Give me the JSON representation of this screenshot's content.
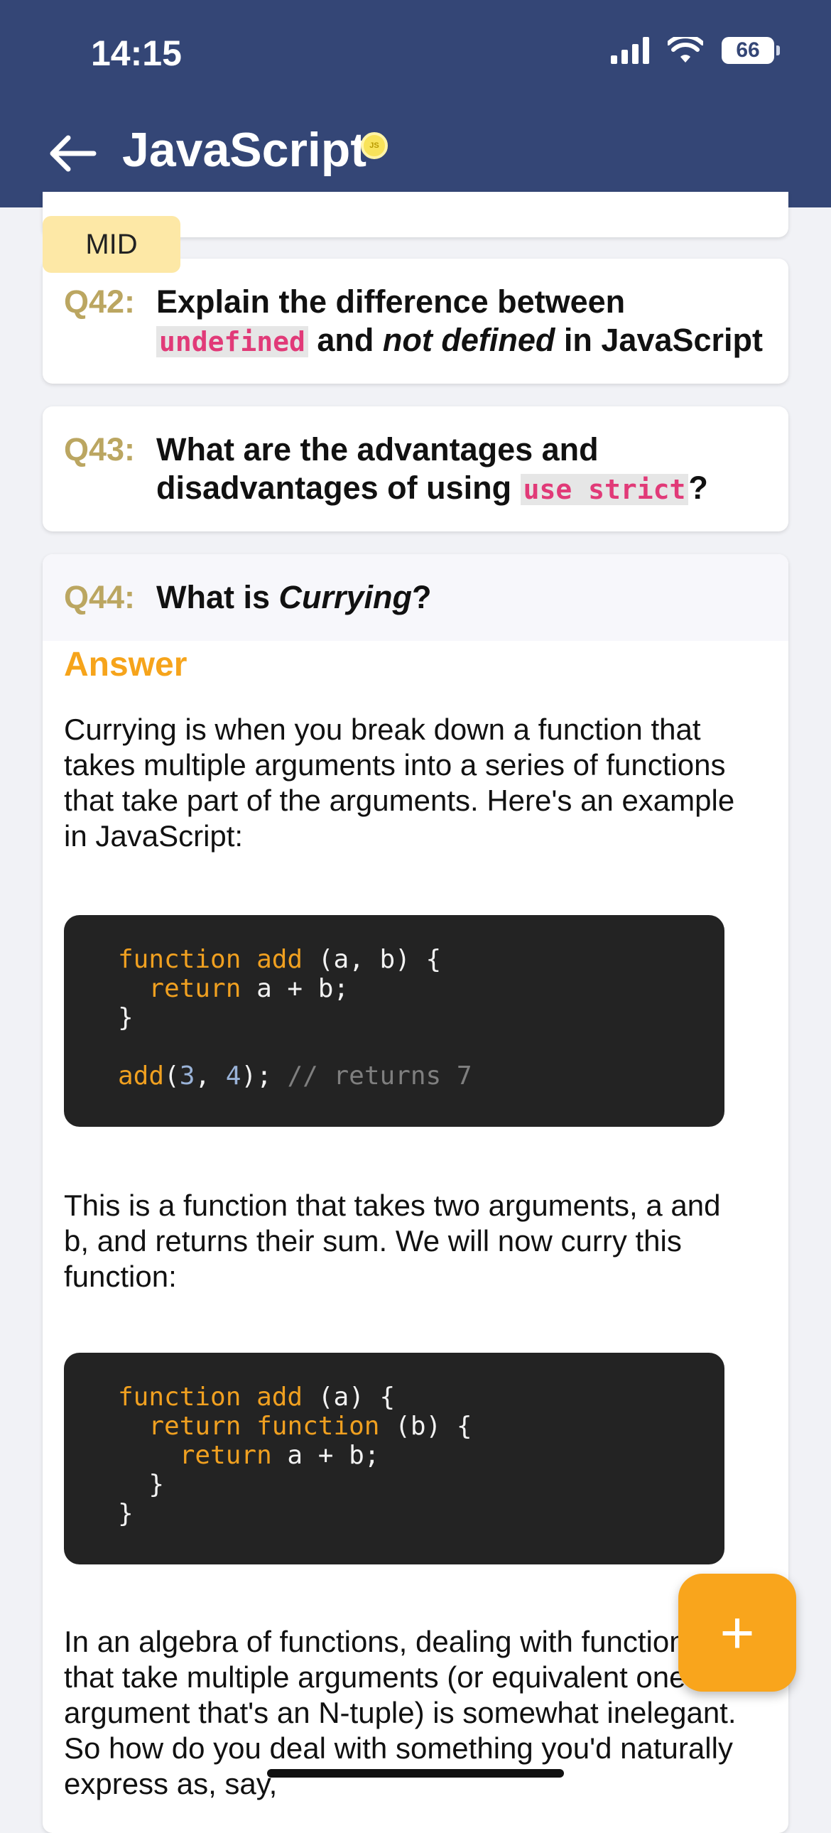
{
  "status_bar": {
    "time": "14:15",
    "battery": "66"
  },
  "header": {
    "title": "JavaScript",
    "badge": "JS"
  },
  "difficulty": "MID",
  "questions": [
    {
      "num": "Q42:",
      "text_a": "Explain the difference between",
      "code": "undefined",
      "text_b": " and ",
      "em": "not defined",
      "text_c": " in JavaScript"
    },
    {
      "num": "Q43:",
      "text_a": "What are the advantages and disadvantages of using ",
      "code": "use strict",
      "text_b": "?"
    },
    {
      "num": "Q44:",
      "text_a": "What is ",
      "em": "Currying",
      "text_b": "?"
    }
  ],
  "answer": {
    "label": "Answer",
    "p1": "Currying is when you break down a function that takes multiple arguments into a series of functions that take part of the arguments. Here's an example in JavaScript:",
    "p2": "This is a function that takes two arguments, a and b, and returns their sum. We will now curry this function:",
    "p3": "In an algebra of functions, dealing with functions that take multiple arguments (or equivalent one argument that's an N-tuple) is somewhat inelegant. So how do you deal with something you'd naturally express as, say,"
  },
  "code1": {
    "l1_kw": "function",
    "l1_fn": "add",
    "l1_rest": " (a, b) {",
    "l2_kw": "return",
    "l2_rest": " a + b;",
    "l3": "}",
    "l5_fn": "add",
    "l5_p1": "(",
    "l5_n1": "3",
    "l5_c": ", ",
    "l5_n2": "4",
    "l5_p2": "); ",
    "l5_cm": "// returns 7"
  },
  "code2": {
    "l1_kw": "function",
    "l1_fn": "add",
    "l1_rest": " (a) {",
    "l2_kw1": "return",
    "l2_kw2": "function",
    "l2_rest": " (b) {",
    "l3_kw": "return",
    "l3_rest": " a + b;",
    "l4": "}",
    "l5": "}"
  },
  "fab": {
    "label": "+"
  },
  "colors": {
    "header": "#344676",
    "accent": "#f9a51c",
    "question_num": "#bba661",
    "code_bg": "#232323"
  }
}
